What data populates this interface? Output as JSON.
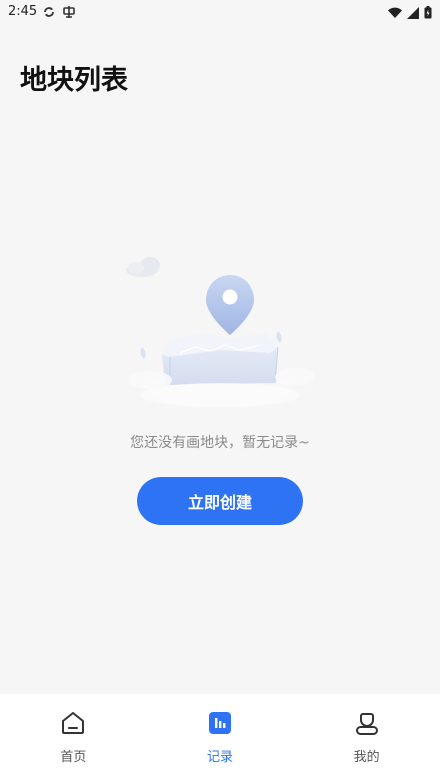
{
  "status_bar": {
    "time": "2:45",
    "left_icons": [
      "sync-icon",
      "notification-app-icon"
    ],
    "right_icons": [
      "wifi-icon",
      "signal-icon",
      "battery-icon"
    ]
  },
  "header": {
    "title": "地块列表"
  },
  "empty_state": {
    "illustration": "map-pin-field-illustration",
    "message": "您还没有画地块，暂无记录~",
    "button_label": "立即创建"
  },
  "bottom_nav": {
    "items": [
      {
        "label": "首页",
        "icon": "home-icon",
        "active": false
      },
      {
        "label": "记录",
        "icon": "records-icon",
        "active": true
      },
      {
        "label": "我的",
        "icon": "profile-icon",
        "active": false
      }
    ]
  },
  "colors": {
    "accent": "#2f73f5",
    "background": "#f6f6f6",
    "nav_background": "#ffffff",
    "muted_text": "#8a8a8a"
  }
}
